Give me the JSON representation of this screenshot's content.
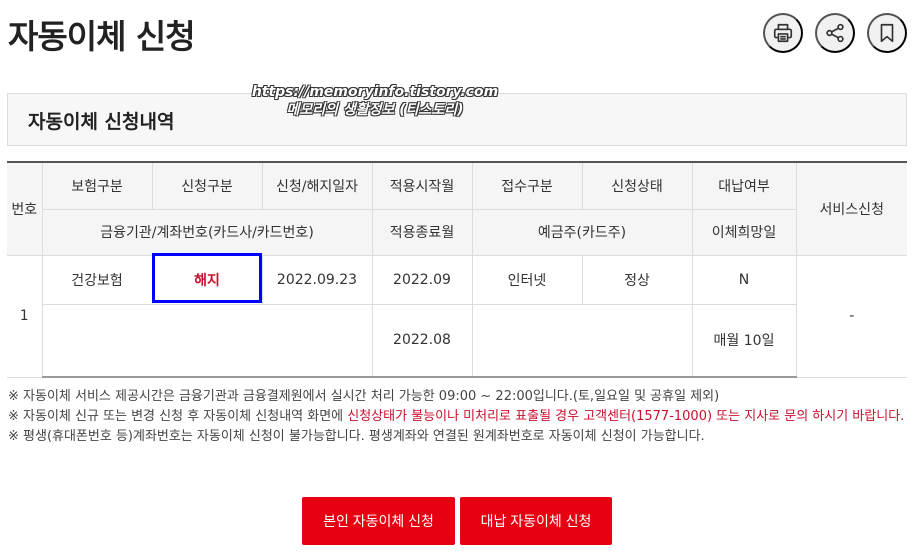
{
  "page": {
    "title": "자동이체 신청"
  },
  "header_icons": [
    "printer-icon",
    "share-icon",
    "bookmark-icon"
  ],
  "watermark": {
    "line1": "https://memoryinfo.tistory.com",
    "line2": "메모리의 생활정보 (티스토리)"
  },
  "section": {
    "title": "자동이체 신청내역"
  },
  "table": {
    "headers": {
      "no": "번호",
      "insurance_type": "보험구분",
      "request_type": "신청구분",
      "request_date": "신청/해지일자",
      "start_month": "적용시작월",
      "receipt_type": "접수구분",
      "status": "신청상태",
      "proxy_payment": "대납여부",
      "service": "서비스신청",
      "bank_account": "금융기관/계좌번호(카드사/카드번호)",
      "end_month": "적용종료월",
      "account_holder": "예금주(카드주)",
      "transfer_day": "이체희망일"
    },
    "rows": [
      {
        "no": "1",
        "insurance_type": "건강보험",
        "request_type": "해지",
        "request_date": "2022.09.23",
        "start_month": "2022.09",
        "receipt_type": "인터넷",
        "status": "정상",
        "proxy_payment": "N",
        "service": "-",
        "bank_account": "",
        "end_month": "2022.08",
        "account_holder": "",
        "transfer_day": "매월 10일"
      }
    ]
  },
  "notes": [
    {
      "text": "※ 자동이체 서비스 제공시간은 금융기관과 금융결제원에서 실시간 처리 가능한 09:00 ~ 22:00입니다.(토,일요일 및 공휴일 제외)"
    },
    {
      "prefix": "※ 자동이체 신규 또는 변경 신청 후 자동이체 신청내역 화면에 ",
      "highlight": "신청상태가 불능이나 미처리로 표출될 경우 고객센터(1577-1000) 또는 지사로 문의 하시기 바랍니다."
    },
    {
      "text": "※ 평생(휴대폰번호 등)계좌번호는 자동이체 신청이 불가능합니다. 평생계좌와 연결된 원계좌번호로 자동이체 신청이 가능합니다."
    }
  ],
  "buttons": {
    "self_apply": "본인 자동이체 신청",
    "proxy_apply": "대납 자동이체 신청"
  },
  "colors": {
    "accent_red": "#e60012",
    "highlight_blue": "#0000ff",
    "text_red": "#c8102e"
  }
}
